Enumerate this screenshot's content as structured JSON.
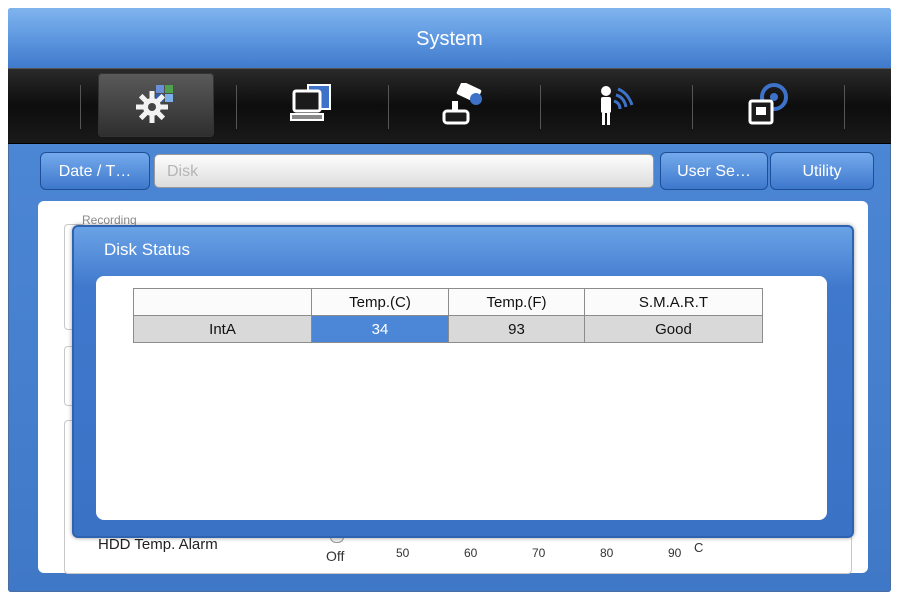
{
  "window": {
    "title": "System"
  },
  "nav": [
    {
      "icon": "system-gear-icon",
      "active": true
    },
    {
      "icon": "computer-network-icon",
      "active": false
    },
    {
      "icon": "camera-device-icon",
      "active": false
    },
    {
      "icon": "event-alarm-person-icon",
      "active": false
    },
    {
      "icon": "storage-disk-icon",
      "active": false
    }
  ],
  "tabs": {
    "date_time": "Date / T…",
    "disk": "Disk",
    "user_setup": "User Se…",
    "utility": "Utility"
  },
  "panel": {
    "group_label": "Recording",
    "hdd_temp_alarm": {
      "label": "HDD Temp. Alarm",
      "value": "Off",
      "scale": [
        "50",
        "60",
        "70",
        "80",
        "90"
      ],
      "unit": "C"
    }
  },
  "dialog": {
    "title": "Disk Status",
    "columns": [
      "",
      "Temp.(C)",
      "Temp.(F)",
      "S.M.A.R.T"
    ],
    "rows": [
      {
        "name": "IntA",
        "temp_c": "34",
        "temp_f": "93",
        "smart": "Good"
      }
    ]
  },
  "colors": {
    "accent": "#4b87d6",
    "title_bar": "#5b95de",
    "icon_bar": "#141414"
  }
}
